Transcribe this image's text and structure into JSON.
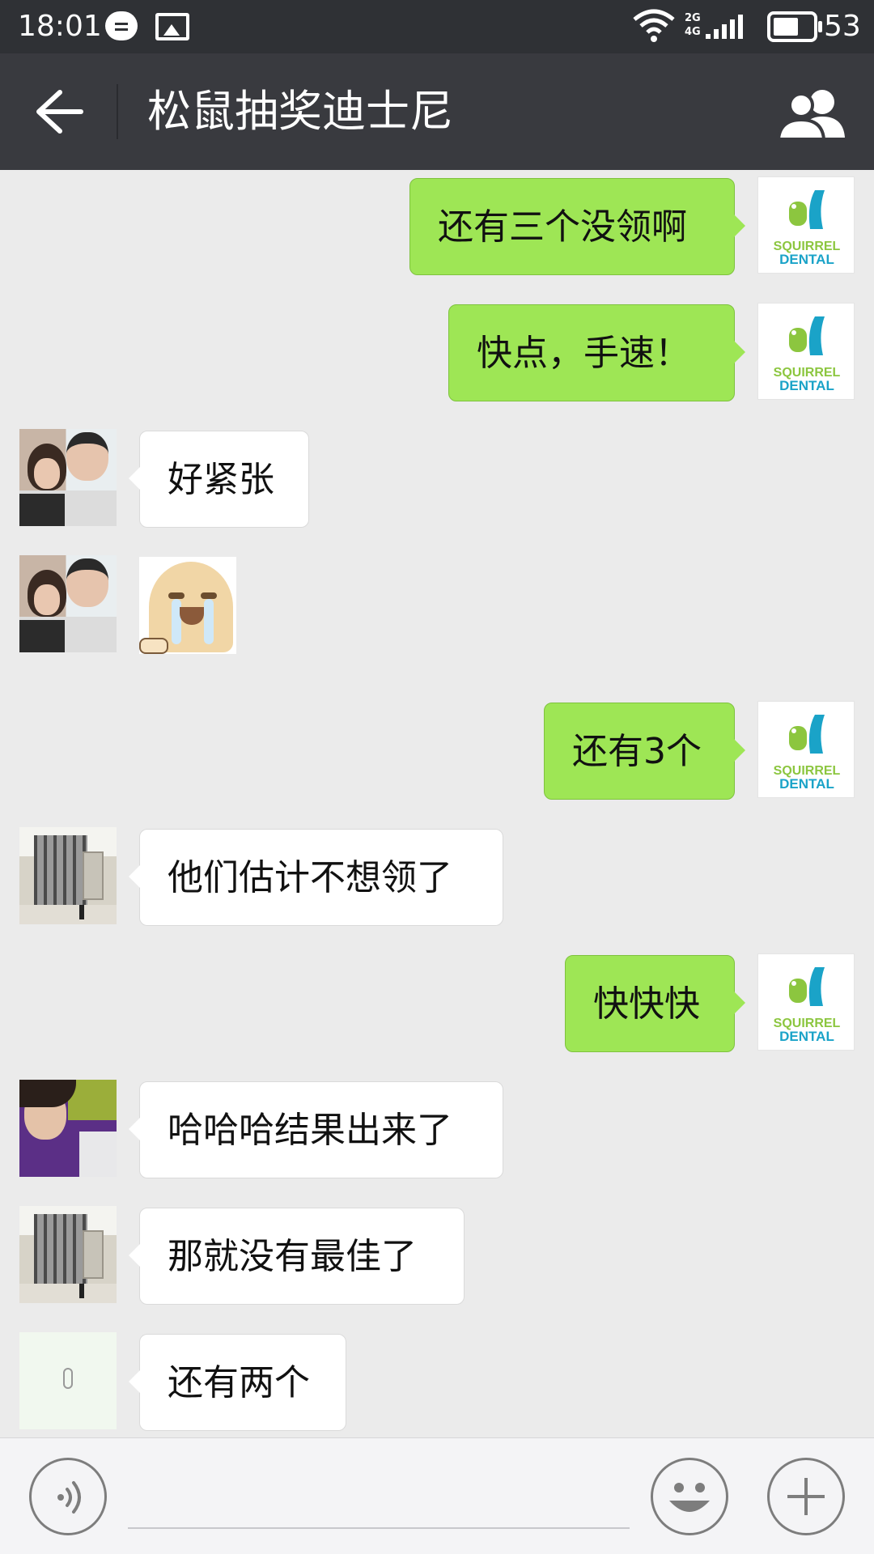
{
  "status_bar": {
    "time": "18:01",
    "network_top": "2G",
    "network_bottom": "4G",
    "battery": "53",
    "icons": [
      "chat-notification-icon",
      "photo-notification-icon",
      "wifi-icon",
      "signal-icon",
      "battery-icon"
    ]
  },
  "header": {
    "title": "松鼠抽奖迪士尼",
    "back_icon": "back-arrow-icon",
    "members_icon": "group-members-icon"
  },
  "colors": {
    "header_bg": "#393a3f",
    "status_bg": "#2f3135",
    "chat_bg": "#ebebeb",
    "my_bubble": "#9ee655",
    "their_bubble": "#ffffff"
  },
  "brand_avatar": {
    "line1": "SQUIRREL",
    "line2": "DENTAL"
  },
  "messages": [
    {
      "side": "mine",
      "text": "还有三个没领啊"
    },
    {
      "side": "mine",
      "text": "快点，手速！"
    },
    {
      "side": "theirs",
      "avatar": "couple",
      "text": "好紧张"
    },
    {
      "side": "theirs",
      "avatar": "couple",
      "sticker": "crying-face-sticker"
    },
    {
      "side": "mine",
      "text": "还有3个"
    },
    {
      "side": "theirs",
      "avatar": "building",
      "text": "他们估计不想领了"
    },
    {
      "side": "mine",
      "text": "快快快"
    },
    {
      "side": "theirs",
      "avatar": "purple",
      "text": "哈哈哈结果出来了"
    },
    {
      "side": "theirs",
      "avatar": "building",
      "text": "那就没有最佳了"
    },
    {
      "side": "theirs",
      "avatar": "plain",
      "text": "还有两个"
    }
  ],
  "input_bar": {
    "voice_icon": "voice-input-icon",
    "text_value": "",
    "emoji_icon": "emoji-icon",
    "plus_icon": "plus-icon"
  }
}
